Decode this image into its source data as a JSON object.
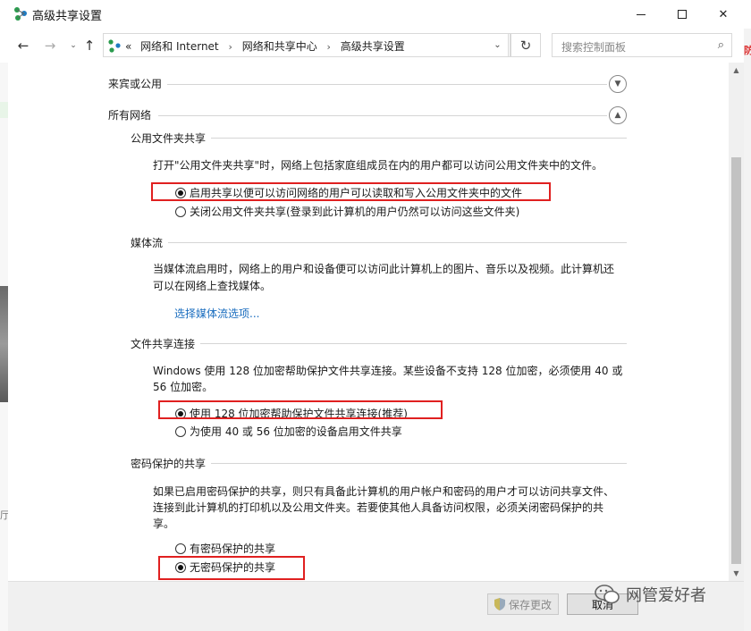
{
  "window": {
    "title": "高级共享设置",
    "minimize_icon": "minimize-icon",
    "maximize_icon": "maximize-icon",
    "close_glyph": "✕"
  },
  "nav": {
    "back_glyph": "←",
    "forward_glyph": "→",
    "up_glyph": "↑",
    "recent_glyph": "⌄",
    "breadcrumb_prefix": "«",
    "breadcrumbs": [
      "网络和 Internet",
      "网络和共享中心",
      "高级共享设置"
    ],
    "sep_glyph": "›",
    "dropdown_glyph": "⌄",
    "refresh_glyph": "↻",
    "search_placeholder": "搜索控制面板",
    "search_glyph": "⌕"
  },
  "sections": {
    "guest": {
      "label": "来宾或公用"
    },
    "all": {
      "label": "所有网络"
    }
  },
  "public_folder": {
    "title": "公用文件夹共享",
    "desc": "打开\"公用文件夹共享\"时，网络上包括家庭组成员在内的用户都可以访问公用文件夹中的文件。",
    "opt_on": "启用共享以便可以访问网络的用户可以读取和写入公用文件夹中的文件",
    "opt_off": "关闭公用文件夹共享(登录到此计算机的用户仍然可以访问这些文件夹)"
  },
  "media": {
    "title": "媒体流",
    "desc1": "当媒体流启用时，网络上的用户和设备便可以访问此计算机上的图片、音乐以及视频。此计算机还",
    "desc2": "可以在网络上查找媒体。",
    "link": "选择媒体流选项..."
  },
  "file_sharing": {
    "title": "文件共享连接",
    "desc1": "Windows 使用 128 位加密帮助保护文件共享连接。某些设备不支持 128 位加密，必须使用 40 或",
    "desc2": "56 位加密。",
    "opt_128": "使用 128 位加密帮助保护文件共享连接(推荐)",
    "opt_40_56": "为使用 40 或 56 位加密的设备启用文件共享"
  },
  "password": {
    "title": "密码保护的共享",
    "desc1": "如果已启用密码保护的共享，则只有具备此计算机的用户帐户和密码的用户才可以访问共享文件、",
    "desc2": "连接到此计算机的打印机以及公用文件夹。若要使其他人具备访问权限，必须关闭密码保护的共",
    "desc3": "享。",
    "opt_on": "有密码保护的共享",
    "opt_off": "无密码保护的共享"
  },
  "footer": {
    "save": "保存更改",
    "cancel": "取消",
    "watermark": "网管爱好者"
  },
  "edges": {
    "left_char": "厅",
    "right_char": "防"
  },
  "colors": {
    "highlight_box": "#e02020",
    "link": "#1a6dbf"
  }
}
